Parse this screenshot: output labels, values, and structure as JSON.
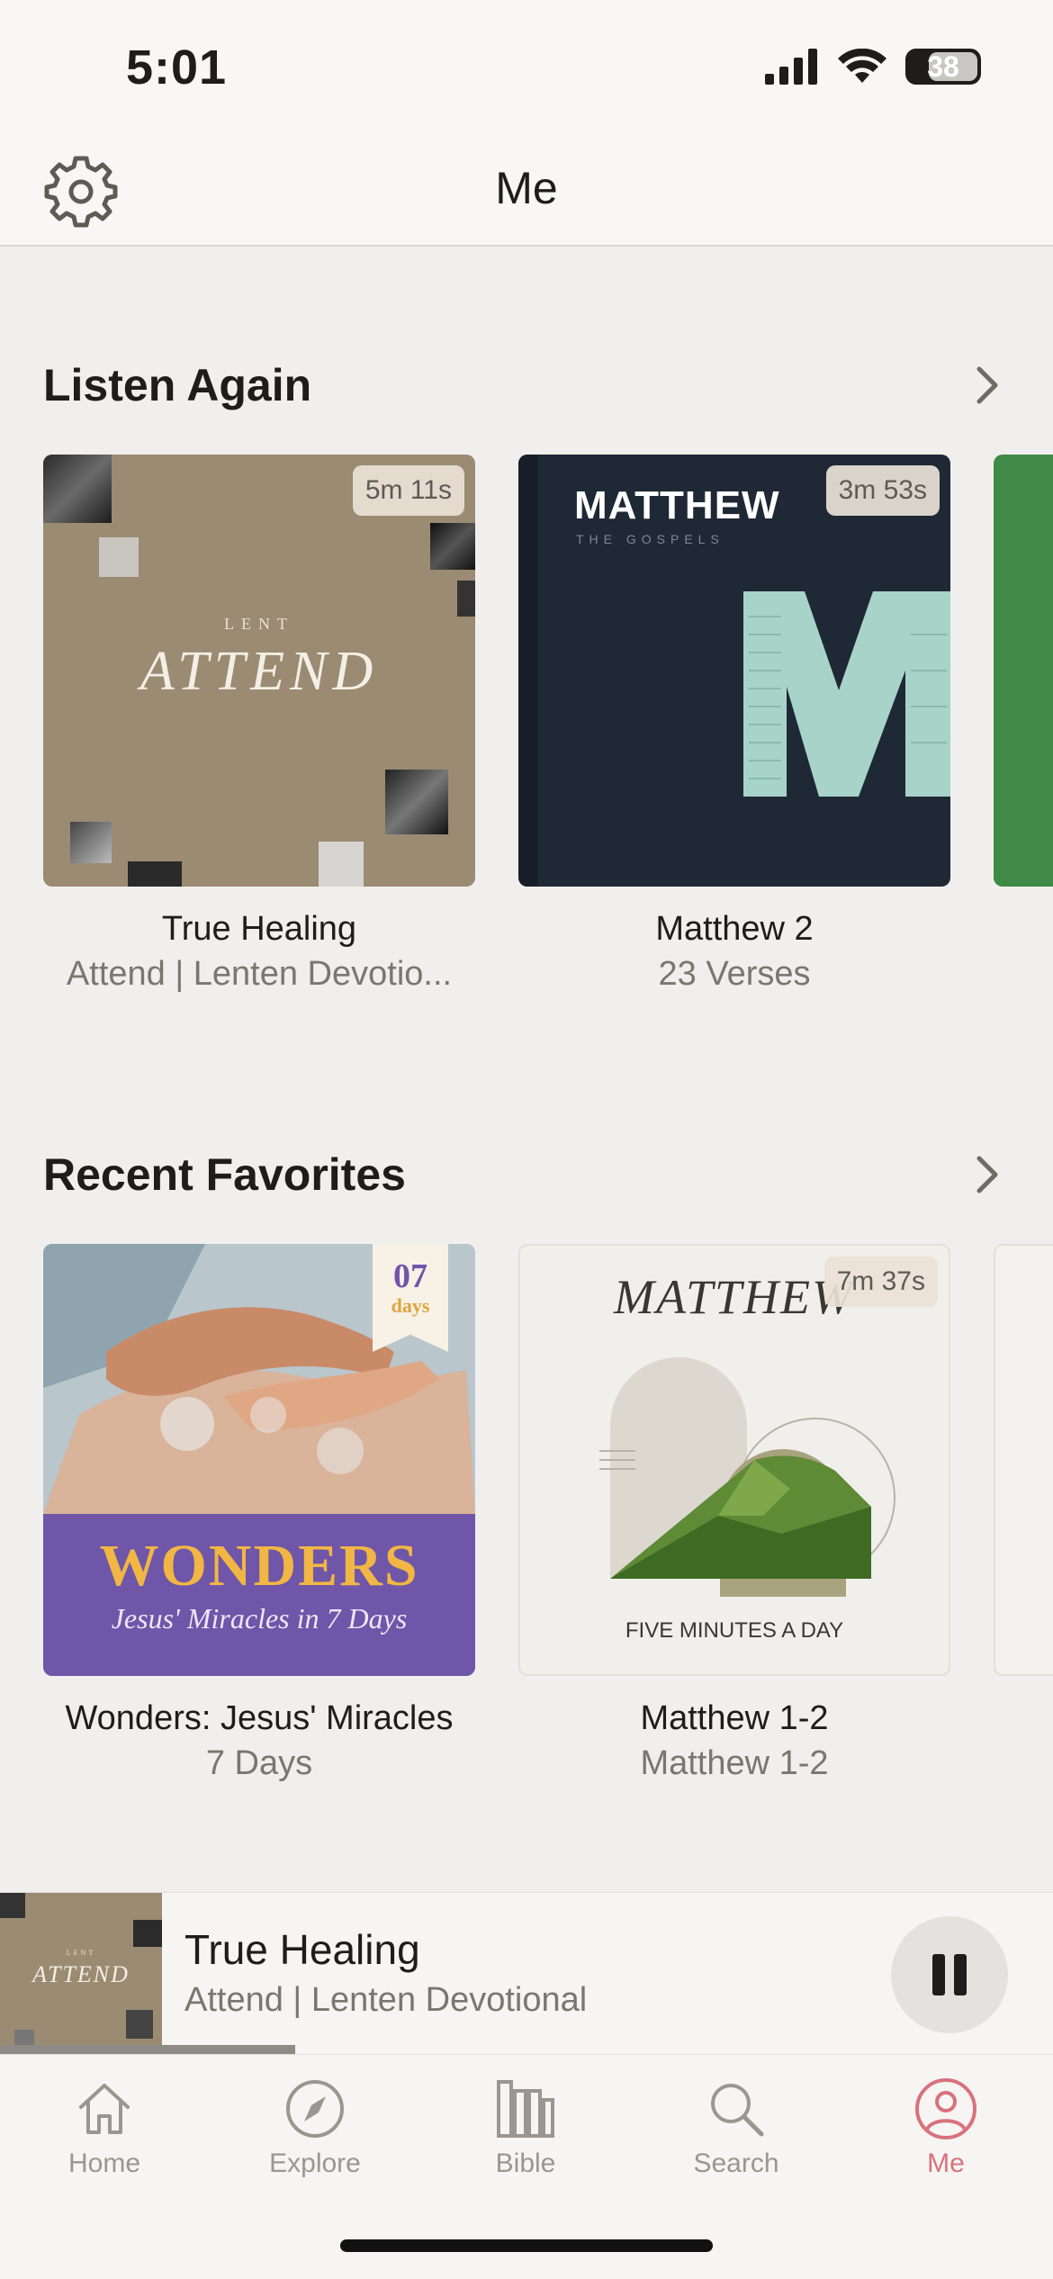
{
  "status_bar": {
    "time": "5:01",
    "battery": "38"
  },
  "header": {
    "title": "Me",
    "settings_icon": "gear-icon"
  },
  "listen_again": {
    "title": "Listen Again",
    "items": [
      {
        "title": "True Healing",
        "subtitle": "Attend | Lenten Devotio...",
        "duration": "5m 11s",
        "art": {
          "kicker": "LENT",
          "word": "ATTEND"
        }
      },
      {
        "title": "Matthew 2",
        "subtitle": "23 Verses",
        "duration": "3m 53s",
        "art": {
          "word": "MATTHEW",
          "kicker": "THE GOSPELS"
        }
      }
    ]
  },
  "recent_favorites": {
    "title": "Recent Favorites",
    "items": [
      {
        "title": "Wonders: Jesus' Miracles",
        "subtitle": "7 Days",
        "art": {
          "word": "WONDERS",
          "tagline": "Jesus' Miracles in 7 Days",
          "days_num": "07",
          "days_label": "days"
        }
      },
      {
        "title": "Matthew 1-2",
        "subtitle": "Matthew 1-2",
        "duration": "7m 37s",
        "art": {
          "word": "MATTHEW",
          "caption": "FIVE MINUTES A DAY"
        }
      }
    ]
  },
  "mini_player": {
    "title": "True Healing",
    "subtitle": "Attend | Lenten Devotional",
    "progress": 0.28,
    "thumb": {
      "kicker": "LENT",
      "word": "ATTEND"
    }
  },
  "tabs": [
    {
      "label": "Home",
      "icon": "home-icon",
      "active": false
    },
    {
      "label": "Explore",
      "icon": "compass-icon",
      "active": false
    },
    {
      "label": "Bible",
      "icon": "bible-icon",
      "active": false
    },
    {
      "label": "Search",
      "icon": "search-icon",
      "active": false
    },
    {
      "label": "Me",
      "icon": "person-icon",
      "active": true
    }
  ],
  "colors": {
    "accent": "#d8727c",
    "background": "#f0efed",
    "wonders_purple": "#6f56a8",
    "matthew_navy": "#1f2835"
  }
}
